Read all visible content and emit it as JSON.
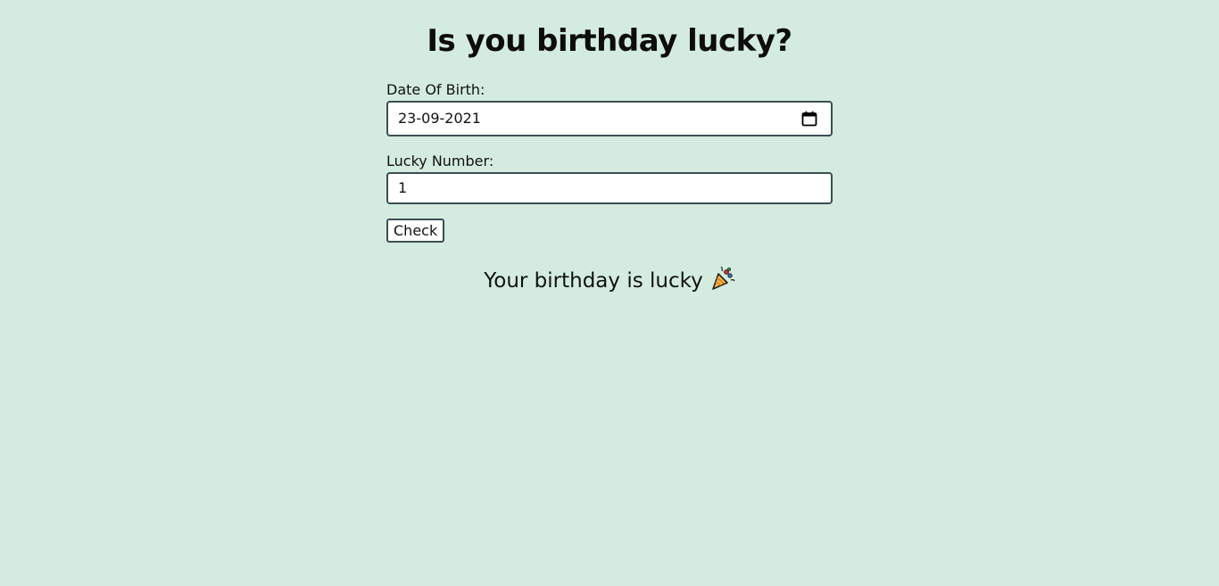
{
  "page": {
    "title": "Is you birthday lucky?",
    "background_color": "#d4ecdf"
  },
  "form": {
    "dob_label": "Date Of Birth:",
    "dob_value": "23-09-2021",
    "dob_icon": "calendar-icon",
    "lucky_label": "Lucky Number:",
    "lucky_value": "1",
    "check_label": "Check",
    "border_color": "#3a4f55"
  },
  "result": {
    "message": "Your birthday is lucky",
    "icon": "party-popper-icon"
  }
}
